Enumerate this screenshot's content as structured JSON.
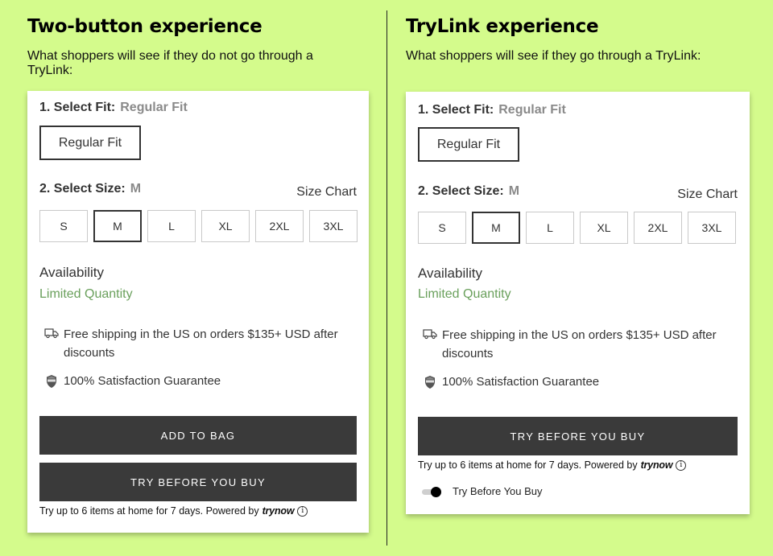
{
  "left": {
    "title": "Two-button experience",
    "description": "What shoppers will see if they do not go through a TryLink:",
    "fit_label": "1. Select Fit:",
    "fit_value": "Regular Fit",
    "fit_option": "Regular Fit",
    "size_label": "2. Select Size:",
    "size_value": "M",
    "size_chart": "Size Chart",
    "sizes": [
      "S",
      "M",
      "L",
      "XL",
      "2XL",
      "3XL"
    ],
    "selected_size": "M",
    "availability_label": "Availability",
    "availability_value": "Limited Quantity",
    "shipping_text": "Free shipping in the US on orders $135+ USD after discounts",
    "guarantee_text": "100% Satisfaction Guarantee",
    "add_to_bag": "ADD TO BAG",
    "try_before": "TRY BEFORE YOU BUY",
    "note": "Try up to 6 items at home for 7 days. Powered by",
    "brand": "trynow"
  },
  "right": {
    "title": "TryLink experience",
    "description": "What shoppers will see if they go through a TryLink:",
    "fit_label": "1. Select Fit:",
    "fit_value": "Regular Fit",
    "fit_option": "Regular Fit",
    "size_label": "2. Select Size:",
    "size_value": "M",
    "size_chart": "Size Chart",
    "sizes": [
      "S",
      "M",
      "L",
      "XL",
      "2XL",
      "3XL"
    ],
    "selected_size": "M",
    "availability_label": "Availability",
    "availability_value": "Limited Quantity",
    "shipping_text": "Free shipping in the US on orders $135+ USD after discounts",
    "guarantee_text": "100% Satisfaction Guarantee",
    "try_before": "TRY BEFORE YOU BUY",
    "note": "Try up to 6 items at home for 7 days. Powered by",
    "brand": "trynow",
    "toggle_label": "Try Before You Buy",
    "toggle_on": true
  },
  "colors": {
    "background": "#d4fb8c",
    "button_dark": "#3a3a3a",
    "availability": "#6aa05c"
  },
  "icons": {
    "shipping": "delivery-truck-icon",
    "guarantee": "badge-shield-icon",
    "info": "info-icon"
  }
}
